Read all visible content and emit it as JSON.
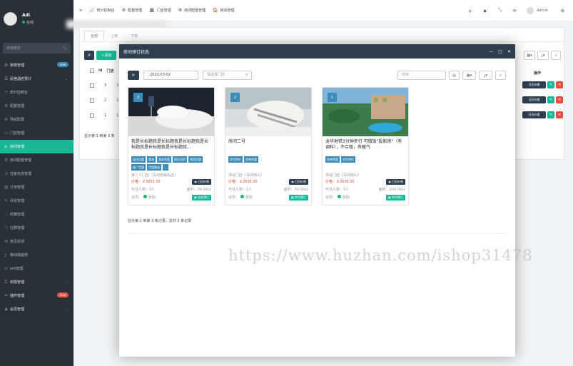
{
  "sidebar": {
    "user_name": "Adi",
    "user_status": "在线",
    "search_placeholder": "搜索菜单",
    "items": [
      {
        "label": "常规管理",
        "icon": "gear-icon",
        "badge": "new",
        "type": "head"
      },
      {
        "label": "民宿酒店预订",
        "icon": "list-icon",
        "type": "head",
        "arrow": "⌄"
      },
      {
        "label": "统计控制台",
        "icon": "chart-icon",
        "type": "sub"
      },
      {
        "label": "配置管理",
        "icon": "gear-icon",
        "type": "sub"
      },
      {
        "label": "导航配置",
        "icon": "nav-icon",
        "type": "sub"
      },
      {
        "label": "门店管理",
        "icon": "store-icon",
        "type": "sub"
      },
      {
        "label": "房间管理",
        "icon": "home-icon",
        "type": "active"
      },
      {
        "label": "房间配置管理",
        "icon": "gear-icon",
        "type": "sub"
      },
      {
        "label": "住客信息管理",
        "icon": "user-icon",
        "type": "sub"
      },
      {
        "label": "订单管理",
        "icon": "order-icon",
        "type": "sub"
      },
      {
        "label": "评论管理",
        "icon": "comment-icon",
        "type": "sub"
      },
      {
        "label": "收藏管理",
        "icon": "heart-icon",
        "type": "sub"
      },
      {
        "label": "社群管理",
        "icon": "group-icon",
        "type": "sub"
      },
      {
        "label": "意见反馈",
        "icon": "feedback-icon",
        "type": "sub"
      },
      {
        "label": "移动端装修",
        "icon": "mobile-icon",
        "type": "sub"
      },
      {
        "label": "wifi管理",
        "icon": "wifi-icon",
        "type": "sub"
      },
      {
        "label": "权限管理",
        "icon": "lock-icon",
        "type": "head",
        "arrow": "‹"
      },
      {
        "label": "插件管理",
        "icon": "plugin-icon",
        "type": "head",
        "badge": "new",
        "badge_color": "red"
      },
      {
        "label": "会员管理",
        "icon": "member-icon",
        "type": "head",
        "arrow": "‹"
      }
    ]
  },
  "topbar": {
    "menu_icon": "≡",
    "nav": [
      {
        "icon": "chart-icon",
        "glyph": "📈",
        "label": "统计控制台"
      },
      {
        "icon": "gear-icon",
        "glyph": "⚙",
        "label": "配置管理"
      },
      {
        "icon": "store-icon",
        "glyph": "🏛",
        "label": "门店管理"
      },
      {
        "icon": "gear-icon",
        "glyph": "⚙",
        "label": "房间配置管理"
      },
      {
        "icon": "home-icon",
        "glyph": "🏠",
        "label": "房间管理"
      }
    ],
    "admin_label": "Admin"
  },
  "panel": {
    "tabs": [
      "全部",
      "上架",
      "下架"
    ],
    "add_label": "添加",
    "col_id": "Id",
    "col_door": "门店",
    "col_action": "操作",
    "rows": [
      [
        "3",
        "2"
      ],
      [
        "2",
        "1"
      ],
      [
        "1",
        "1"
      ]
    ],
    "row_btn": "日历价格",
    "footer": "显示第 1 到第 3 条"
  },
  "modal": {
    "title": "房间预订状态",
    "date_value": "2021-03-02",
    "store_placeholder": "请选择门店",
    "search_placeholder": "搜索",
    "footer": "显示第 1 到第 3 条记录，总共 3 条记录",
    "cards": [
      {
        "num": "3",
        "title": "我是长标题我是长标题我是长标题我是长标题我是长标题我是长标题我...",
        "tags": [
          "连住优惠",
          "看海",
          "游泳特惠",
          "网红民宿",
          "海滨优惠",
          "接广优惠",
          "月租惠选",
          "..."
        ],
        "store": "第二个门店（深圳南销岛店）",
        "price": "价格：￥3653.00",
        "cal_btn": "日历价格",
        "people": "可住人数：3人",
        "area": "面积：34.00㎡",
        "status": "状态：",
        "status_text": "有房",
        "book_btn": "去房预订"
      },
      {
        "num": "2",
        "title": "房间二号",
        "tags": [
          "学生特价",
          "首单特惠"
        ],
        "store": "测试门店（深圳南山）",
        "price": "价格：￥2636.00",
        "cal_btn": "日历价格",
        "people": "可住人数：1人",
        "area": "面积：33.00㎡",
        "status": "状态：",
        "status_text": "有房",
        "book_btn": "房间预订"
      },
      {
        "num": "1",
        "title": "龙华地铁3分钟步行 可做饭\"投影房\"（有调料），不合租，有暖气",
        "tags": [
          "首单特惠",
          "学生特价"
        ],
        "store": "测试门店（深圳南山）",
        "price": "价格：￥2636.00",
        "cal_btn": "日历价格",
        "people": "可住人数：3人",
        "area": "面积：200.00㎡",
        "status": "状态：",
        "status_text": "有房",
        "book_btn": "房间预订"
      }
    ]
  },
  "watermark": "https://www.huzhan.com/ishop31478",
  "colors": {
    "sidebar": "#2a3038",
    "accent": "#18b896",
    "dark_btn": "#2c3e50",
    "tag": "#3c8dbc",
    "price": "#e74c3c"
  }
}
